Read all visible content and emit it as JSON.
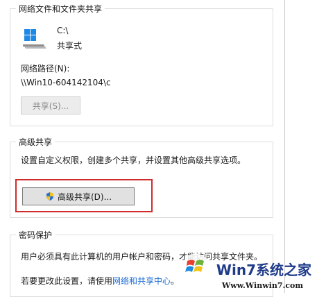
{
  "network_share": {
    "group_label": "网络文件和文件夹共享",
    "drive_path": "C:\\",
    "share_status": "共享式",
    "network_path_label": "网络路径(N):",
    "network_path_value": "\\\\Win10-604142104\\c",
    "share_button_label": "共享(S)..."
  },
  "advanced_share": {
    "group_label": "高级共享",
    "description": "设置自定义权限，创建多个共享，并设置其他高级共享选项。",
    "button_label": "高级共享(D)..."
  },
  "password_protection": {
    "group_label": "密码保护",
    "description": "用户必须具有此计算机的用户帐户和密码，才能访问共享文件夹。",
    "change_prefix": "若要更改此设置，请使用",
    "link_text": "网络和共享中心",
    "change_suffix": "。"
  },
  "watermark": {
    "brand": "Win7系统之家",
    "url": "Www.Winwin7.com"
  },
  "colors": {
    "highlight_border": "#d12b2b",
    "link": "#1a6bd6",
    "windows_blue": "#1e88e5"
  }
}
